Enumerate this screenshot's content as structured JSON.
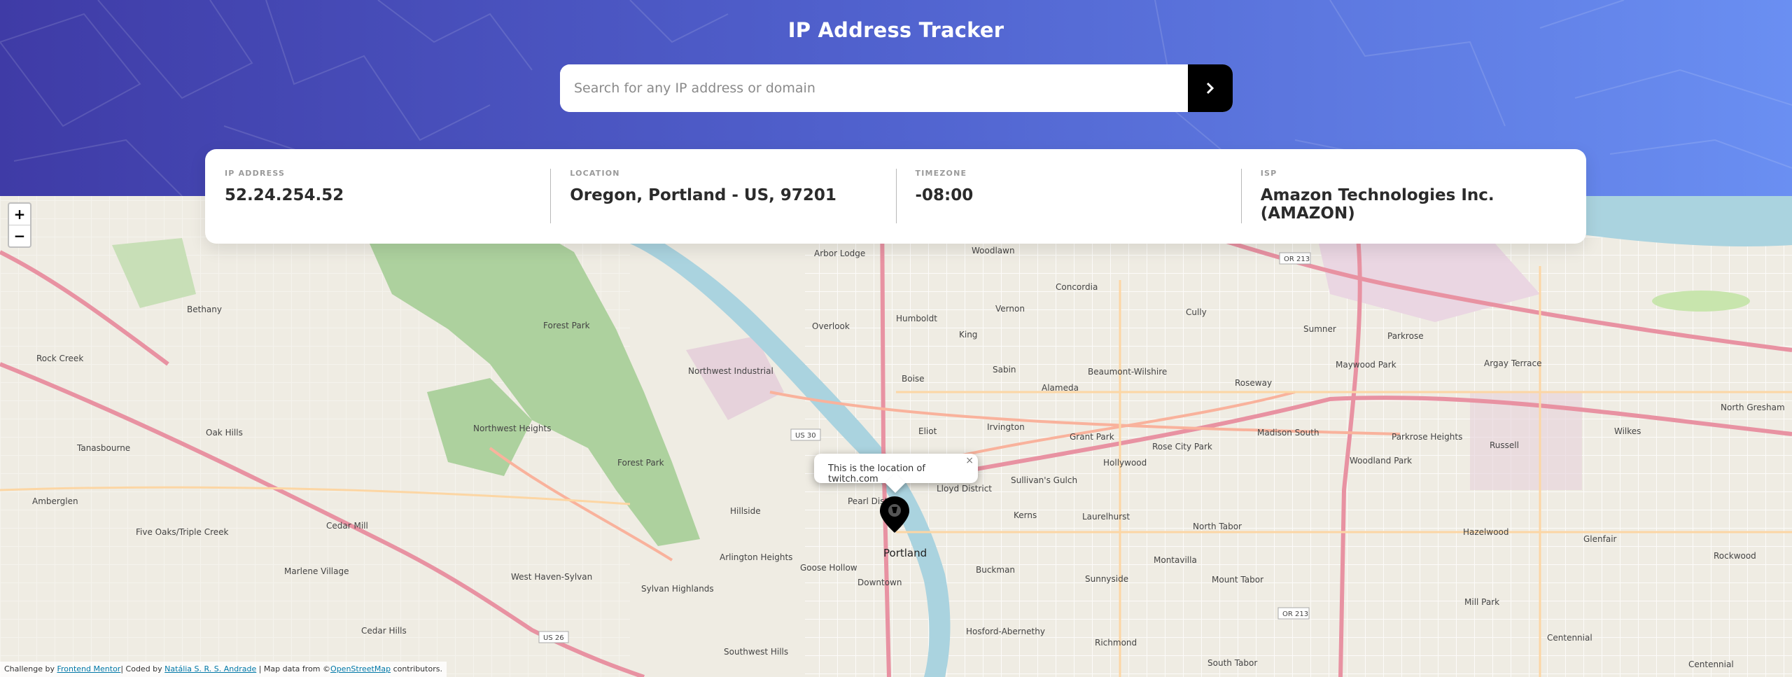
{
  "header": {
    "title": "IP Address Tracker",
    "search_placeholder": "Search for any IP address or domain",
    "search_value": "",
    "submit_icon": "chevron-right-icon"
  },
  "info": [
    {
      "label": "IP ADDRESS",
      "value": "52.24.254.52"
    },
    {
      "label": "LOCATION",
      "value": "Oregon, Portland - US, 97201"
    },
    {
      "label": "TIMEZONE",
      "value": "-08:00"
    },
    {
      "label": "ISP",
      "value": "Amazon Technologies Inc. (AMAZON)"
    }
  ],
  "map": {
    "zoom_in": "+",
    "zoom_out": "−",
    "popup_text": "This is the location of twitch.com",
    "popup_close": "×",
    "marker_icon": "location-pin-icon",
    "labels": {
      "arbor_lodge": "Arbor Lodge",
      "woodlawn": "Woodlawn",
      "concordia": "Concordia",
      "cully": "Cully",
      "sumner": "Sumner",
      "parkrose": "Parkrose",
      "humboldt": "Humboldt",
      "vernon": "Vernon",
      "king": "King",
      "sabin": "Sabin",
      "boise": "Boise",
      "overlook": "Overlook",
      "eliot": "Eliot",
      "irvington": "Irvington",
      "alameda": "Alameda",
      "beaumont": "Beaumont-Wilshire",
      "roseway": "Roseway",
      "maywood_park": "Maywood Park",
      "argay_terrace": "Argay Terrace",
      "north_gresham": "North Gresham",
      "forest_park": "Forest Park",
      "northwest_industrial": "Northwest Industrial",
      "northwest_heights": "Northwest Heights",
      "bethany": "Bethany",
      "rock_creek": "Rock Creek",
      "oak_hills": "Oak Hills",
      "tanasbourne": "Tanasbourne",
      "amberglen": "Amberglen",
      "cedar_mill": "Cedar Mill",
      "five_oaks": "Five Oaks/Triple Creek",
      "marlene_village": "Marlene Village",
      "cedar_hills": "Cedar Hills",
      "west_haven": "West Haven-Sylvan",
      "sylvan_highlands": "Sylvan Highlands",
      "arlington_heights": "Arlington Heights",
      "hillside": "Hillside",
      "goose_hollow": "Goose Hollow",
      "downtown": "Downtown",
      "portland": "Portland",
      "pearl_district": "Pearl District",
      "lloyd_district": "Lloyd District",
      "sullivans_gulch": "Sullivan's Gulch",
      "grant_park": "Grant Park",
      "rose_city_park": "Rose City Park",
      "hollywood": "Hollywood",
      "madison_south": "Madison South",
      "parkrose_heights": "Parkrose Heights",
      "russell": "Russell",
      "wilkes": "Wilkes",
      "woodland_park": "Woodland Park",
      "kerns": "Kerns",
      "laurelhurst": "Laurelhurst",
      "north_tabor": "North Tabor",
      "hazelwood": "Hazelwood",
      "glenfair": "Glenfair",
      "rockwood": "Rockwood",
      "buckman": "Buckman",
      "montavilla": "Montavilla",
      "sunnyside": "Sunnyside",
      "mount_tabor": "Mount Tabor",
      "mill_park": "Mill Park",
      "centennial": "Centennial",
      "richmond": "Richmond",
      "south_tabor": "South Tabor",
      "hosford": "Hosford-Abernethy",
      "southwest_hills": "Southwest Hills",
      "us30": "US 30",
      "us26": "US 26",
      "or213": "OR 213"
    }
  },
  "attribution": {
    "challenge_prefix": "Challenge by",
    "challenge_link": "Frontend Mentor",
    "coded_prefix": "| Coded by",
    "coded_link": "Natália S. R. S. Andrade",
    "map_prefix": "| Map data from ©",
    "map_link": "OpenStreetMap",
    "map_suffix": "contributors."
  },
  "colors": {
    "header_gradient_start": "#3f3ba6",
    "header_gradient_end": "#6a8ff2",
    "button_bg": "#000000",
    "label_gray": "#9a9a9a",
    "value_dark": "#2b2b2b",
    "forest_green": "#a9cf8d",
    "river_blue": "#aad3df",
    "major_road": "#e892a2"
  }
}
